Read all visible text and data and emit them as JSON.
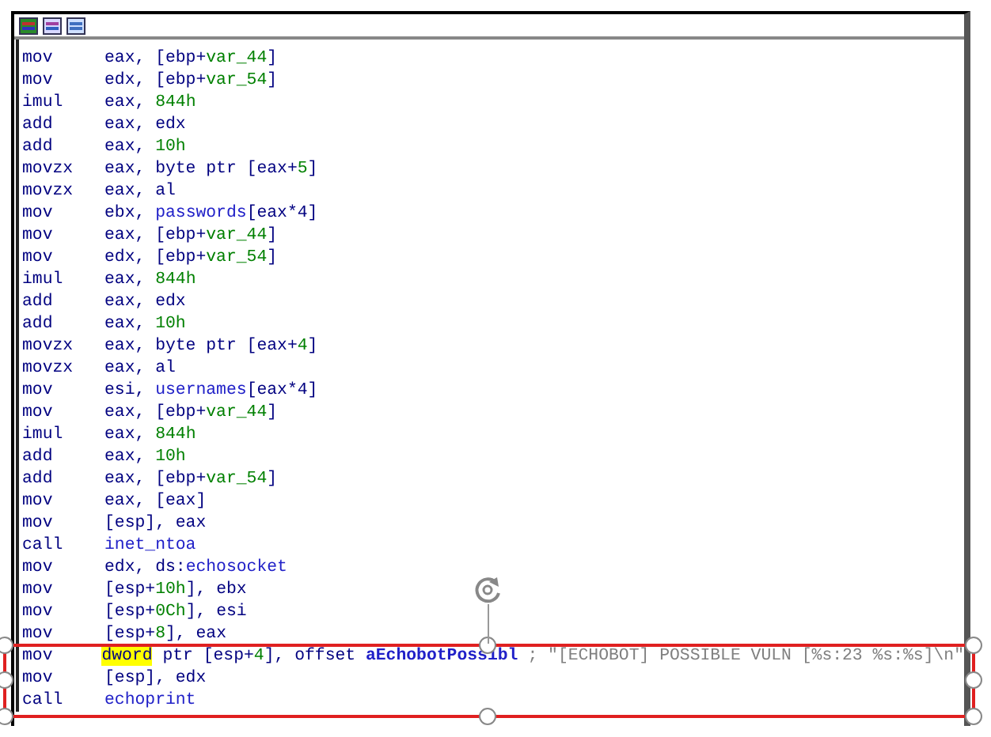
{
  "lines": [
    {
      "mnemonic": "mov",
      "operands": [
        {
          "text": "eax, [ebp+",
          "kind": "reg"
        },
        {
          "text": "var_44",
          "kind": "num"
        },
        {
          "text": "]",
          "kind": "reg"
        }
      ]
    },
    {
      "mnemonic": "mov",
      "operands": [
        {
          "text": "edx, [ebp+",
          "kind": "reg"
        },
        {
          "text": "var_54",
          "kind": "num"
        },
        {
          "text": "]",
          "kind": "reg"
        }
      ]
    },
    {
      "mnemonic": "imul",
      "operands": [
        {
          "text": "eax, ",
          "kind": "reg"
        },
        {
          "text": "844h",
          "kind": "num"
        }
      ]
    },
    {
      "mnemonic": "add",
      "operands": [
        {
          "text": "eax, edx",
          "kind": "reg"
        }
      ]
    },
    {
      "mnemonic": "add",
      "operands": [
        {
          "text": "eax, ",
          "kind": "reg"
        },
        {
          "text": "10h",
          "kind": "num"
        }
      ]
    },
    {
      "mnemonic": "movzx",
      "operands": [
        {
          "text": "eax, byte ptr [eax+",
          "kind": "reg"
        },
        {
          "text": "5",
          "kind": "num"
        },
        {
          "text": "]",
          "kind": "reg"
        }
      ]
    },
    {
      "mnemonic": "movzx",
      "operands": [
        {
          "text": "eax, al",
          "kind": "reg"
        }
      ]
    },
    {
      "mnemonic": "mov",
      "operands": [
        {
          "text": "ebx, ",
          "kind": "reg"
        },
        {
          "text": "passwords",
          "kind": "name"
        },
        {
          "text": "[eax*4]",
          "kind": "reg"
        }
      ]
    },
    {
      "mnemonic": "mov",
      "operands": [
        {
          "text": "eax, [ebp+",
          "kind": "reg"
        },
        {
          "text": "var_44",
          "kind": "num"
        },
        {
          "text": "]",
          "kind": "reg"
        }
      ]
    },
    {
      "mnemonic": "mov",
      "operands": [
        {
          "text": "edx, [ebp+",
          "kind": "reg"
        },
        {
          "text": "var_54",
          "kind": "num"
        },
        {
          "text": "]",
          "kind": "reg"
        }
      ]
    },
    {
      "mnemonic": "imul",
      "operands": [
        {
          "text": "eax, ",
          "kind": "reg"
        },
        {
          "text": "844h",
          "kind": "num"
        }
      ]
    },
    {
      "mnemonic": "add",
      "operands": [
        {
          "text": "eax, edx",
          "kind": "reg"
        }
      ]
    },
    {
      "mnemonic": "add",
      "operands": [
        {
          "text": "eax, ",
          "kind": "reg"
        },
        {
          "text": "10h",
          "kind": "num"
        }
      ]
    },
    {
      "mnemonic": "movzx",
      "operands": [
        {
          "text": "eax, byte ptr [eax+",
          "kind": "reg"
        },
        {
          "text": "4",
          "kind": "num"
        },
        {
          "text": "]",
          "kind": "reg"
        }
      ]
    },
    {
      "mnemonic": "movzx",
      "operands": [
        {
          "text": "eax, al",
          "kind": "reg"
        }
      ]
    },
    {
      "mnemonic": "mov",
      "operands": [
        {
          "text": "esi, ",
          "kind": "reg"
        },
        {
          "text": "usernames",
          "kind": "name"
        },
        {
          "text": "[eax*4]",
          "kind": "reg"
        }
      ]
    },
    {
      "mnemonic": "mov",
      "operands": [
        {
          "text": "eax, [ebp+",
          "kind": "reg"
        },
        {
          "text": "var_44",
          "kind": "num"
        },
        {
          "text": "]",
          "kind": "reg"
        }
      ]
    },
    {
      "mnemonic": "imul",
      "operands": [
        {
          "text": "eax, ",
          "kind": "reg"
        },
        {
          "text": "844h",
          "kind": "num"
        }
      ]
    },
    {
      "mnemonic": "add",
      "operands": [
        {
          "text": "eax, ",
          "kind": "reg"
        },
        {
          "text": "10h",
          "kind": "num"
        }
      ]
    },
    {
      "mnemonic": "add",
      "operands": [
        {
          "text": "eax, [ebp+",
          "kind": "reg"
        },
        {
          "text": "var_54",
          "kind": "num"
        },
        {
          "text": "]",
          "kind": "reg"
        }
      ]
    },
    {
      "mnemonic": "mov",
      "operands": [
        {
          "text": "eax, [eax]",
          "kind": "reg"
        }
      ]
    },
    {
      "mnemonic": "mov",
      "operands": [
        {
          "text": "[esp], eax",
          "kind": "reg"
        }
      ]
    },
    {
      "mnemonic": "call",
      "operands": [
        {
          "text": "inet_ntoa",
          "kind": "name"
        }
      ]
    },
    {
      "mnemonic": "mov",
      "operands": [
        {
          "text": "edx, ds:",
          "kind": "reg"
        },
        {
          "text": "echosocket",
          "kind": "name"
        }
      ]
    },
    {
      "mnemonic": "mov",
      "operands": [
        {
          "text": "[esp+",
          "kind": "reg"
        },
        {
          "text": "10h",
          "kind": "num"
        },
        {
          "text": "], ebx",
          "kind": "reg"
        }
      ]
    },
    {
      "mnemonic": "mov",
      "operands": [
        {
          "text": "[esp+",
          "kind": "reg"
        },
        {
          "text": "0Ch",
          "kind": "num"
        },
        {
          "text": "], esi",
          "kind": "reg"
        }
      ]
    },
    {
      "mnemonic": "mov",
      "operands": [
        {
          "text": "[esp+",
          "kind": "reg"
        },
        {
          "text": "8",
          "kind": "num"
        },
        {
          "text": "], eax",
          "kind": "reg"
        }
      ]
    },
    {
      "mnemonic": "mov",
      "operands": [
        {
          "text": "dword",
          "kind": "highlight"
        },
        {
          "text": " ptr [esp+",
          "kind": "reg"
        },
        {
          "text": "4",
          "kind": "num"
        },
        {
          "text": "], offset ",
          "kind": "reg"
        },
        {
          "text": "aEchobotPossibl",
          "kind": "name"
        }
      ],
      "comment": "; \"[ECHOBOT] POSSIBLE VULN [%s:23 %s:%s]\\n\""
    },
    {
      "mnemonic": "mov",
      "operands": [
        {
          "text": "[esp], edx",
          "kind": "reg"
        }
      ]
    },
    {
      "mnemonic": "call",
      "operands": [
        {
          "text": "echoprint",
          "kind": "name"
        }
      ]
    }
  ]
}
